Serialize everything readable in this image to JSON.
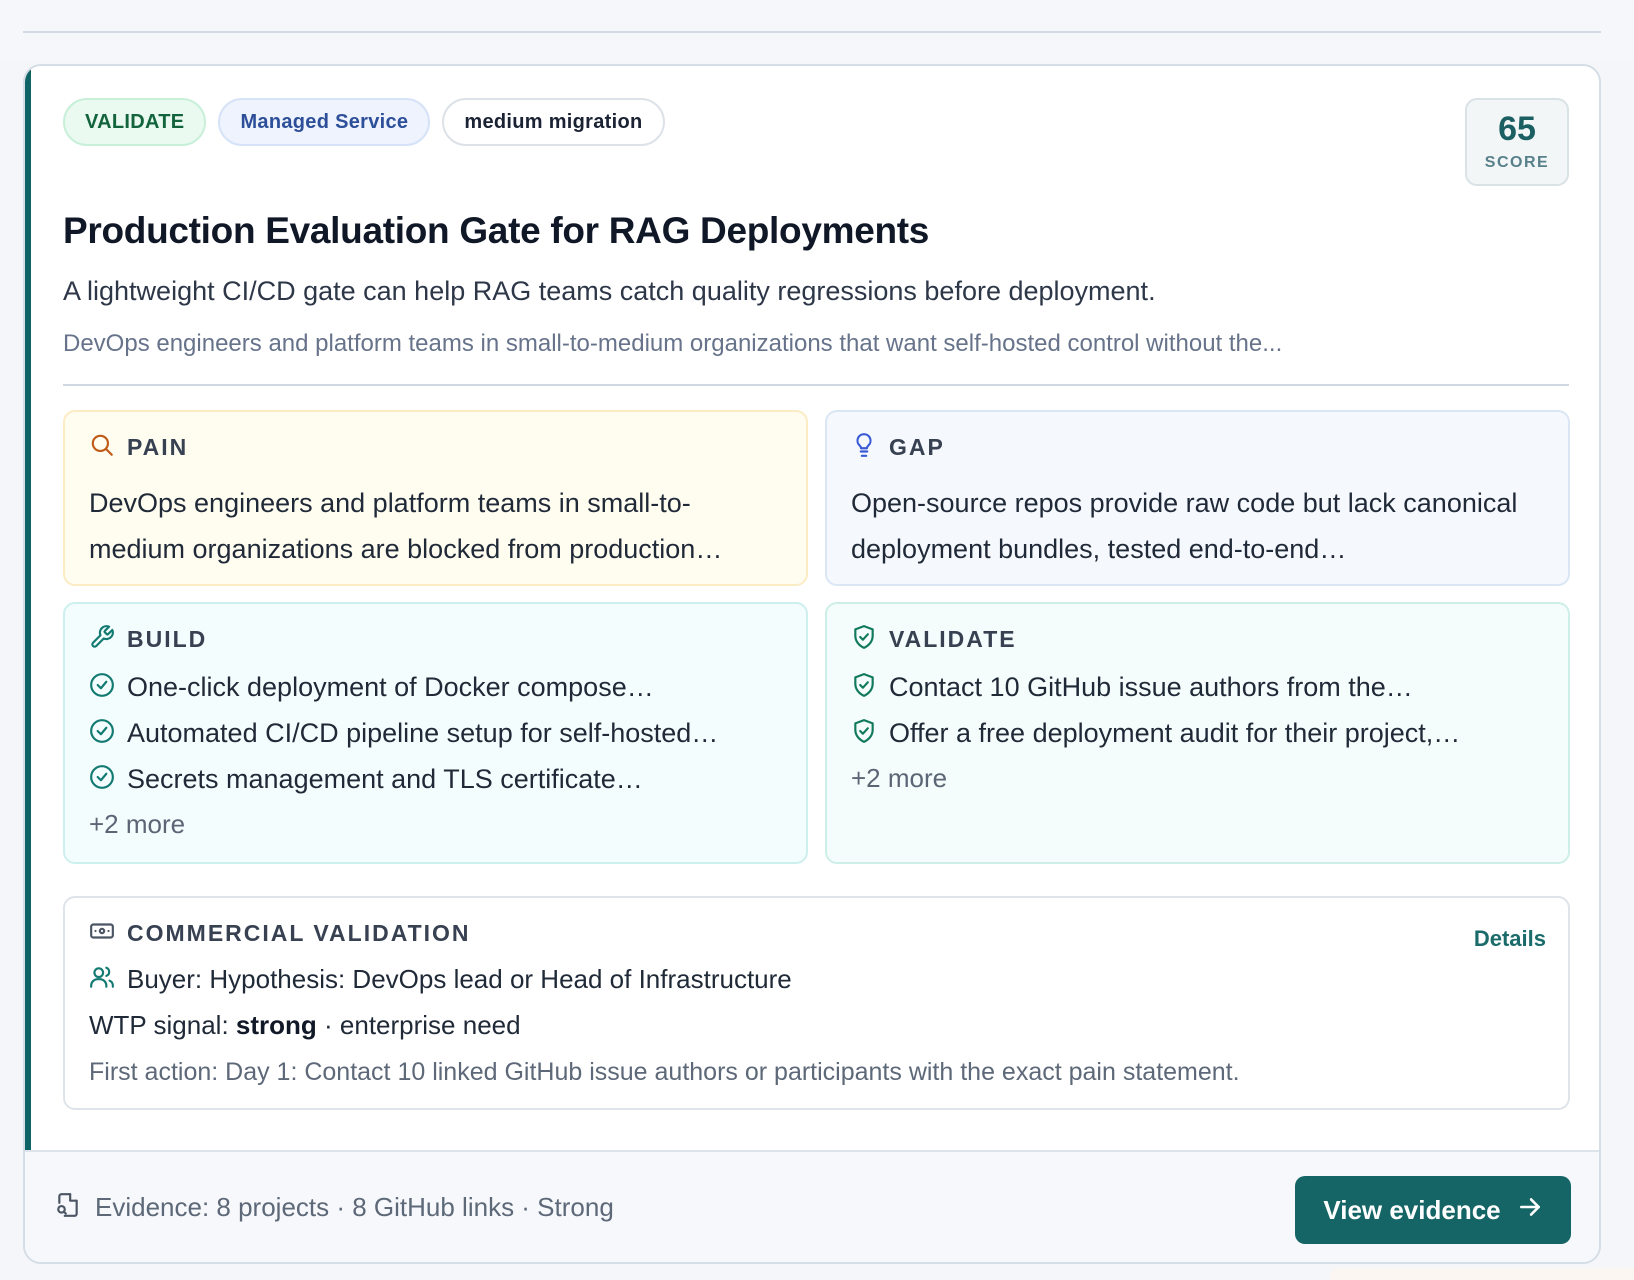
{
  "tags": [
    {
      "label": "VALIDATE"
    },
    {
      "label": "Managed Service"
    },
    {
      "label": "medium migration"
    }
  ],
  "score": {
    "value": "65",
    "label": "SCORE"
  },
  "title": "Production Evaluation Gate for RAG Deployments",
  "summary": "A lightweight CI/CD gate can help RAG teams catch quality regressions before deployment.",
  "audience": "DevOps engineers and platform teams in small-to-medium organizations that want self-hosted control without the...",
  "pain": {
    "label": "PAIN",
    "text": "DevOps engineers and platform teams in small-to-medium organizations are blocked from production…",
    "icon": "search-icon"
  },
  "gap": {
    "label": "GAP",
    "text": "Open-source repos provide raw code but lack canonical deployment bundles, tested end-to-end…",
    "icon": "lightbulb-icon"
  },
  "build": {
    "label": "BUILD",
    "icon": "wrench-icon",
    "items": [
      "One-click deployment of Docker compose…",
      "Automated CI/CD pipeline setup for self-hosted…",
      "Secrets management and TLS certificate…"
    ],
    "more": "+2 more"
  },
  "validate": {
    "label": "VALIDATE",
    "icon": "shield-check-icon",
    "items": [
      "Contact 10 GitHub issue authors from the…",
      "Offer a free deployment audit for their project,…"
    ],
    "more": "+2 more"
  },
  "commercial": {
    "label": "COMMERCIAL VALIDATION",
    "details": "Details",
    "buyer": "Buyer: Hypothesis: DevOps lead or Head of Infrastructure",
    "wtp_prefix": "WTP signal: ",
    "wtp_strength": "strong",
    "wtp_suffix": " · enterprise need",
    "first_action": "First action: Day 1: Contact 10 linked GitHub issue authors or participants with the exact pain statement."
  },
  "footer": {
    "evidence": "Evidence: 8 projects · 8 GitHub links · Strong",
    "button": "View evidence"
  },
  "colors": {
    "accent": "#0f6566",
    "button": "#166566",
    "pain_icon": "#c05a17",
    "gap_icon": "#3b5bd6",
    "build_icon": "#127a72"
  }
}
